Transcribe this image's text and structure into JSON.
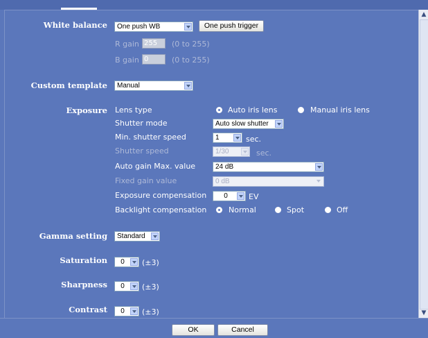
{
  "white_balance": {
    "label": "White balance",
    "mode": "One push WB",
    "trigger_label": "One push trigger",
    "r_gain_label": "R gain",
    "r_gain_value": "255",
    "r_gain_range": "(0 to 255)",
    "b_gain_label": "B gain",
    "b_gain_value": "0",
    "b_gain_range": "(0 to 255)"
  },
  "custom_template": {
    "label": "Custom template",
    "value": "Manual"
  },
  "exposure": {
    "label": "Exposure",
    "lens_type_label": "Lens type",
    "lens_auto": "Auto iris lens",
    "lens_manual": "Manual iris lens",
    "lens_selected": "auto",
    "shutter_mode_label": "Shutter mode",
    "shutter_mode_value": "Auto slow shutter",
    "min_shutter_label": "Min. shutter speed",
    "min_shutter_value": "1",
    "min_shutter_unit": "sec.",
    "shutter_speed_label": "Shutter speed",
    "shutter_speed_value": "1/30",
    "shutter_speed_unit": "sec.",
    "auto_gain_label": "Auto gain Max. value",
    "auto_gain_value": "24 dB",
    "fixed_gain_label": "Fixed gain value",
    "fixed_gain_value": "0 dB",
    "exp_comp_label": "Exposure compensation",
    "exp_comp_value": "0",
    "exp_comp_unit": "EV",
    "backlight_label": "Backlight compensation",
    "backlight_normal": "Normal",
    "backlight_spot": "Spot",
    "backlight_off": "Off",
    "backlight_selected": "normal"
  },
  "gamma": {
    "label": "Gamma setting",
    "value": "Standard"
  },
  "saturation": {
    "label": "Saturation",
    "value": "0",
    "range": "(±3)"
  },
  "sharpness": {
    "label": "Sharpness",
    "value": "0",
    "range": "(±3)"
  },
  "contrast": {
    "label": "Contrast",
    "value": "0",
    "range": "(±3)"
  },
  "buttons": {
    "ok": "OK",
    "cancel": "Cancel"
  },
  "icons": {
    "scroll_up": "scroll-up-icon",
    "scroll_down": "scroll-down-icon",
    "dropdown": "chevron-down-icon"
  },
  "colors": {
    "background": "#5b77bb",
    "text": "#ffffff",
    "disabled_text": "#aeb9d8"
  }
}
